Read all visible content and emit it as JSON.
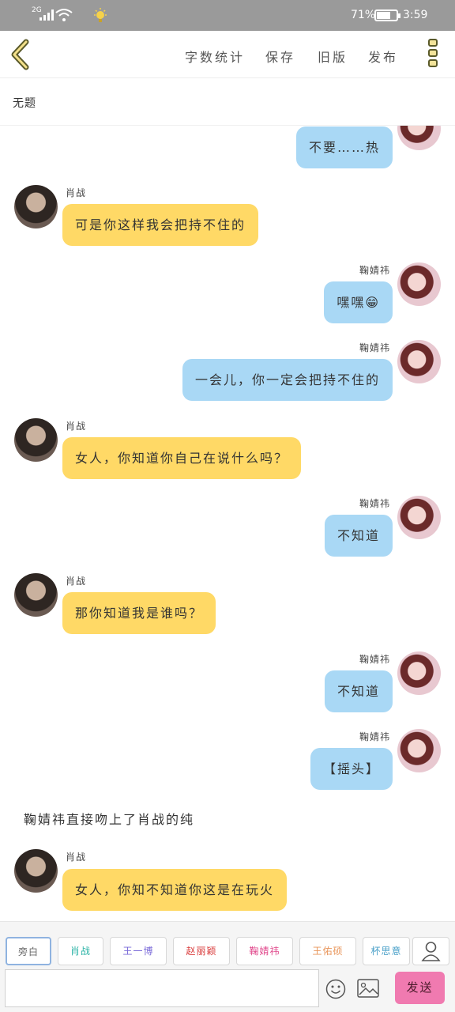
{
  "status_bar": {
    "network": "2G",
    "battery_percent": "71%",
    "battery_level": 0.71,
    "time": "3:59"
  },
  "toolbar": {
    "back_icon": "chevron-left-icon",
    "word_count": "字数统计",
    "save": "保存",
    "old_version": "旧版",
    "publish": "发布",
    "menu_icon": "three-box-menu-icon"
  },
  "document": {
    "title": "无题"
  },
  "messages": [
    {
      "side": "right",
      "speaker": "",
      "text": "不要……热"
    },
    {
      "side": "left",
      "speaker": "肖战",
      "text": "可是你这样我会把持不住的"
    },
    {
      "side": "right",
      "speaker": "鞠婧祎",
      "text": "嘿嘿😁"
    },
    {
      "side": "right",
      "speaker": "鞠婧祎",
      "text": "一会儿，你一定会把持不住的"
    },
    {
      "side": "left",
      "speaker": "肖战",
      "text": "女人，你知道你自己在说什么吗？"
    },
    {
      "side": "right",
      "speaker": "鞠婧祎",
      "text": "不知道"
    },
    {
      "side": "left",
      "speaker": "肖战",
      "text": "那你知道我是谁吗？"
    },
    {
      "side": "right",
      "speaker": "鞠婧祎",
      "text": "不知道"
    },
    {
      "side": "right",
      "speaker": "鞠婧祎",
      "text": "【摇头】"
    },
    {
      "side": "narration",
      "speaker": "",
      "text": "鞠婧祎直接吻上了肖战的纯"
    },
    {
      "side": "left",
      "speaker": "肖战",
      "text": "女人，你知不知道你这是在玩火"
    }
  ],
  "characters": [
    {
      "label": "旁白",
      "color": "#666666"
    },
    {
      "label": "肖战",
      "color": "#2bb3a6"
    },
    {
      "label": "王一博",
      "color": "#7a6ad8"
    },
    {
      "label": "赵丽颖",
      "color": "#d93a3a"
    },
    {
      "label": "鞠婧祎",
      "color": "#e0458a"
    },
    {
      "label": "王佑硕",
      "color": "#e8955a"
    },
    {
      "label": "杯思意",
      "color": "#4aa0c8"
    }
  ],
  "input": {
    "value": "",
    "placeholder": ""
  },
  "send_label": "发送",
  "colors": {
    "left_bubble": "#ffd966",
    "right_bubble": "#a9d8f5",
    "send_button": "#f07ab0"
  }
}
